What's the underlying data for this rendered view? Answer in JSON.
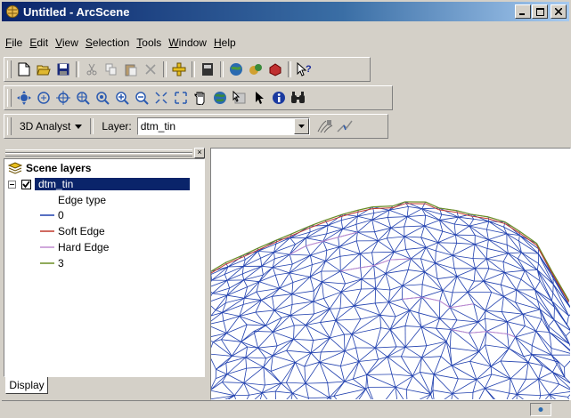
{
  "window": {
    "title": "Untitled - ArcScene",
    "app_icon": "arcscene-globe-icon",
    "buttons": [
      "minimize-icon",
      "maximize-icon",
      "close-icon"
    ]
  },
  "menubar": {
    "items": [
      {
        "label": "File",
        "u": "F",
        "rest": "ile"
      },
      {
        "label": "Edit",
        "u": "E",
        "rest": "dit"
      },
      {
        "label": "View",
        "u": "V",
        "rest": "iew"
      },
      {
        "label": "Selection",
        "u": "S",
        "rest": "election"
      },
      {
        "label": "Tools",
        "u": "T",
        "rest": "ools"
      },
      {
        "label": "Window",
        "u": "W",
        "rest": "indow"
      },
      {
        "label": "Help",
        "u": "H",
        "rest": "elp"
      }
    ]
  },
  "toolbar_standard": [
    "new-icon",
    "open-icon",
    "save-icon",
    "cut-icon",
    "copy-icon",
    "paste-icon",
    "delete-icon",
    "add-data-icon",
    "scene-properties-icon",
    "arc-toolbox-icon",
    "globe-icon",
    "3d-analyst-icon",
    "whats-this-icon"
  ],
  "toolbar_tools": [
    "navigate-icon",
    "fly-icon",
    "center-target-icon",
    "zoom-target-icon",
    "set-observer-icon",
    "zoom-in-icon",
    "zoom-out-icon",
    "narrow-fov-icon",
    "expand-fov-icon",
    "pan-icon",
    "full-extent-icon",
    "select-graphics-icon",
    "select-pointer-icon",
    "identify-icon",
    "find-icon"
  ],
  "analyst_toolbar": {
    "menu_label": "3D Analyst",
    "layer_label": "Layer:",
    "layer_value": "dtm_tin",
    "tools": [
      "create-contour-icon",
      "steepest-path-icon"
    ]
  },
  "toc": {
    "root_label": "Scene layers",
    "layer": {
      "name": "dtm_tin",
      "checked": true,
      "expanded": true
    },
    "legend_heading": "Edge type",
    "legend_items": [
      {
        "label": "0",
        "color": "#1f3fae"
      },
      {
        "label": "Soft Edge",
        "color": "#c0392b"
      },
      {
        "label": "Hard Edge",
        "color": "#c08ad0"
      },
      {
        "label": "3",
        "color": "#6b8e23"
      }
    ]
  },
  "tabs": {
    "display_label": "Display"
  },
  "status": {
    "icon": "status-indicator-icon"
  }
}
